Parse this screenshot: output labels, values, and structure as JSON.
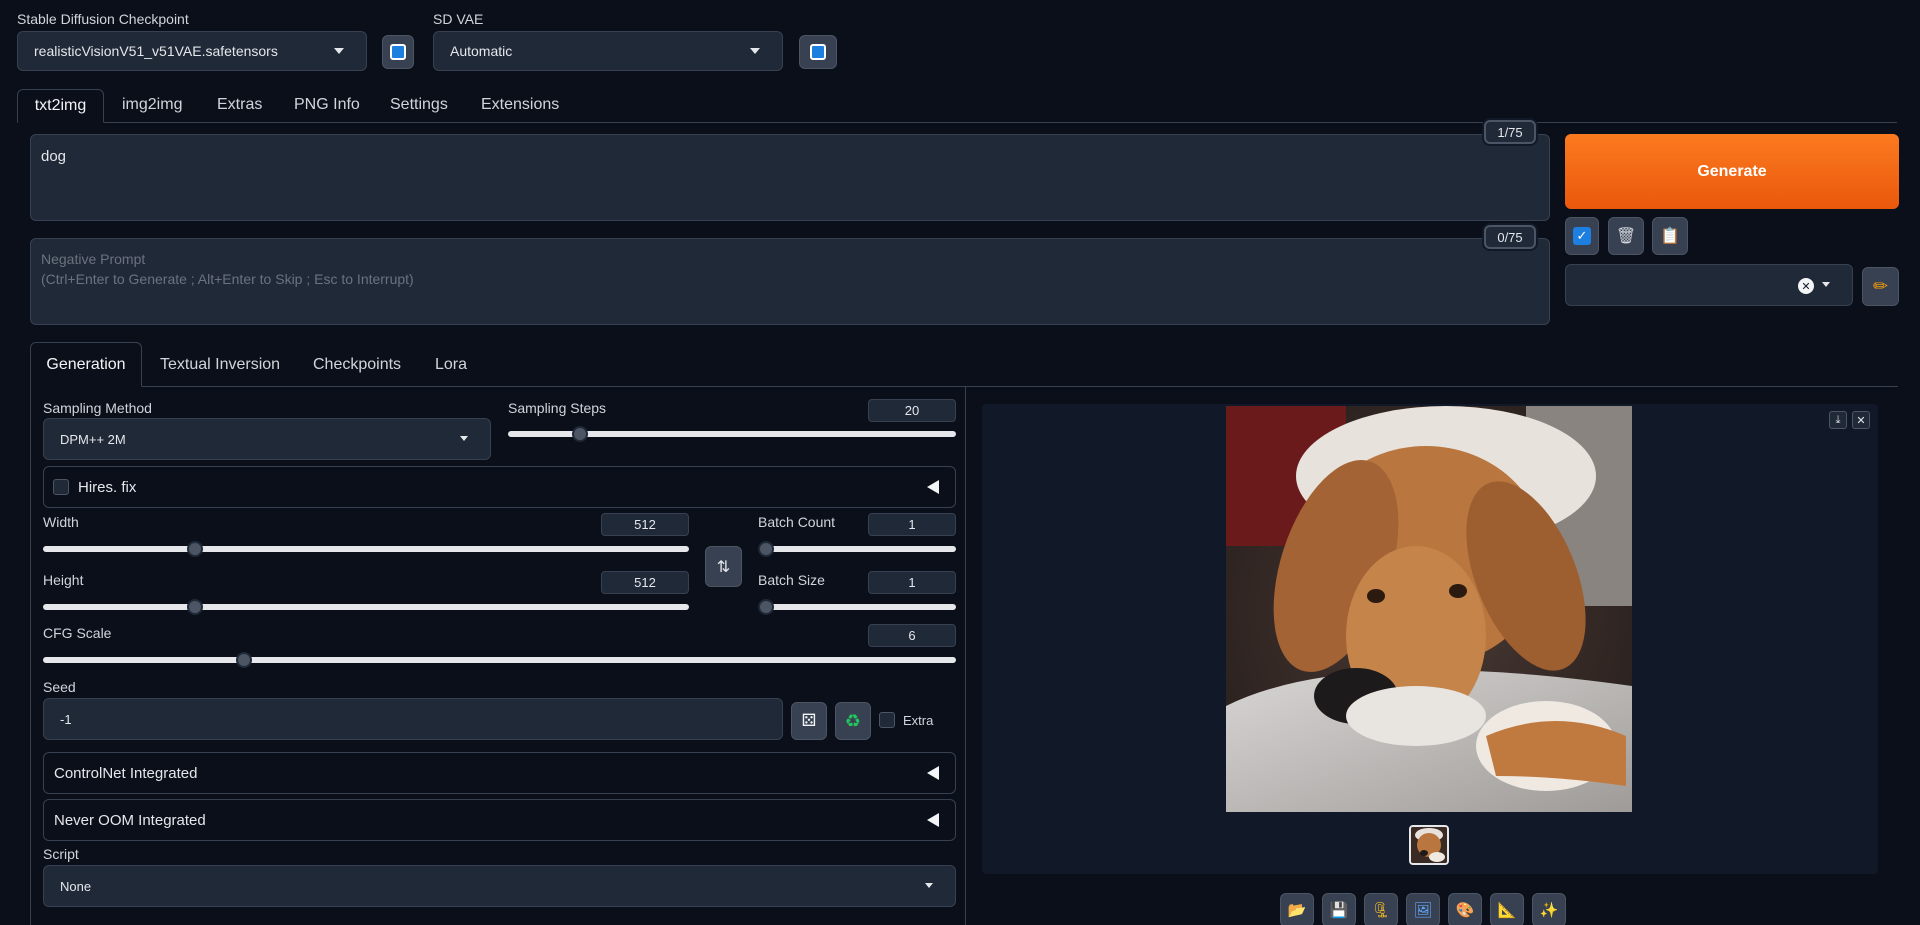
{
  "header": {
    "checkpoint_label": "Stable Diffusion Checkpoint",
    "checkpoint_value": "realisticVisionV51_v51VAE.safetensors",
    "vae_label": "SD VAE",
    "vae_value": "Automatic"
  },
  "main_tabs": [
    "txt2img",
    "img2img",
    "Extras",
    "PNG Info",
    "Settings",
    "Extensions"
  ],
  "prompt": {
    "value": "dog",
    "counter": "1/75"
  },
  "negative_prompt": {
    "placeholder_line1": "Negative Prompt",
    "placeholder_line2": "(Ctrl+Enter to Generate ; Alt+Enter to Skip ; Esc to Interrupt)",
    "counter": "0/75"
  },
  "generate_label": "Generate",
  "sub_tabs": [
    "Generation",
    "Textual Inversion",
    "Checkpoints",
    "Lora"
  ],
  "sampling": {
    "method_label": "Sampling Method",
    "method_value": "DPM++ 2M",
    "steps_label": "Sampling Steps",
    "steps_value": "20",
    "steps_fraction": 0.16
  },
  "hires": {
    "label": "Hires. fix"
  },
  "width": {
    "label": "Width",
    "value": "512",
    "fraction": 0.236
  },
  "height": {
    "label": "Height",
    "value": "512",
    "fraction": 0.236
  },
  "batch_count": {
    "label": "Batch Count",
    "value": "1",
    "fraction": 0.0
  },
  "batch_size": {
    "label": "Batch Size",
    "value": "1",
    "fraction": 0.0
  },
  "cfg": {
    "label": "CFG Scale",
    "value": "6",
    "fraction": 0.22
  },
  "seed": {
    "label": "Seed",
    "value": "-1",
    "extra_label": "Extra"
  },
  "controlnet": {
    "label": "ControlNet Integrated"
  },
  "never_oom": {
    "label": "Never OOM Integrated"
  },
  "script": {
    "label": "Script",
    "value": "None"
  },
  "colors": {
    "accent": "#f97316",
    "background": "#0b0f19",
    "panel": "#1f2937",
    "border": "#374151"
  },
  "icons": {
    "refresh": "refresh-icon",
    "checkbox": "checkbox-icon",
    "trash": "trash-icon",
    "clipboard": "clipboard-icon",
    "pencil": "pencil-icon",
    "swap": "swap-icon",
    "dice": "dice-icon",
    "recycle": "recycle-icon",
    "download": "download-icon",
    "close": "close-icon",
    "folder": "folder-icon",
    "save": "save-icon",
    "zip": "zip-icon",
    "image": "image-icon",
    "palette": "palette-icon",
    "ruler": "ruler-icon",
    "sparkle": "sparkle-icon"
  }
}
